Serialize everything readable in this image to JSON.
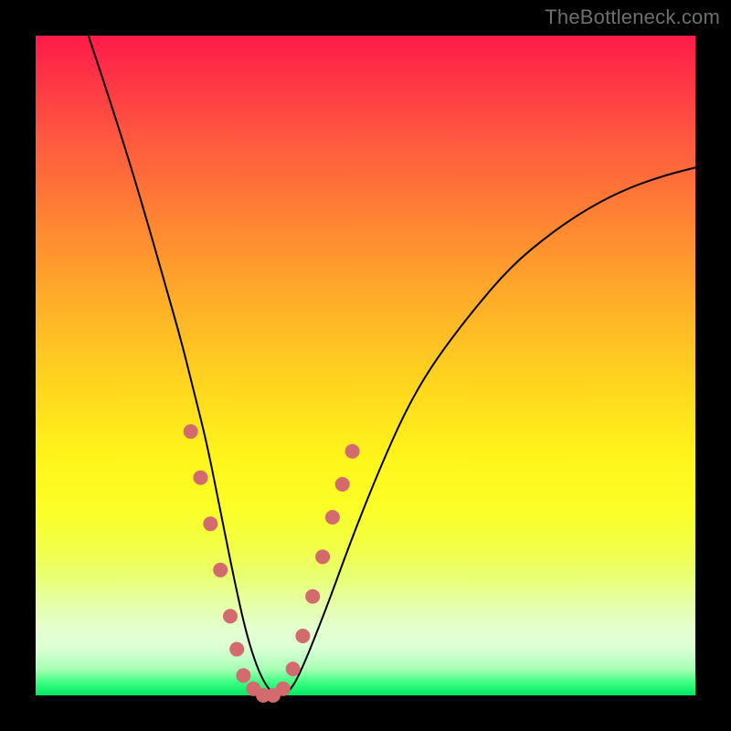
{
  "watermark": "TheBottleneck.com",
  "colors": {
    "frame_bg": "#000000",
    "curve": "#000000",
    "marker": "#d36a6e",
    "gradient_top": "#ff1b49",
    "gradient_bottom": "#00e862"
  },
  "chart_data": {
    "type": "line",
    "title": "",
    "xlabel": "",
    "ylabel": "",
    "xlim": [
      0,
      100
    ],
    "ylim": [
      0,
      100
    ],
    "note": "Axes are unlabeled; values are pixel-fraction estimates (0–100) of the V-shaped bottleneck curve. y≈100 top, y≈0 bottom.",
    "series": [
      {
        "name": "bottleneck-curve",
        "x": [
          8,
          12,
          16,
          20,
          22,
          24,
          26,
          28,
          30,
          32,
          34,
          36,
          38,
          40,
          44,
          48,
          52,
          56,
          60,
          66,
          72,
          78,
          84,
          90,
          96,
          100
        ],
        "y": [
          100,
          88,
          75,
          61,
          54,
          46,
          38,
          28,
          18,
          9,
          3,
          0,
          0,
          3,
          13,
          24,
          34,
          43,
          50,
          58,
          65,
          70,
          74,
          77,
          79,
          80
        ]
      }
    ],
    "markers": {
      "name": "highlighted-points",
      "x": [
        23.5,
        25.0,
        26.5,
        28.0,
        29.5,
        30.5,
        31.5,
        33.0,
        34.5,
        36.0,
        37.5,
        39.0,
        40.5,
        42.0,
        43.5,
        45.0,
        46.5,
        48.0
      ],
      "y": [
        40,
        33,
        26,
        19,
        12,
        7,
        3,
        1,
        0,
        0,
        1,
        4,
        9,
        15,
        21,
        27,
        32,
        37
      ]
    }
  }
}
